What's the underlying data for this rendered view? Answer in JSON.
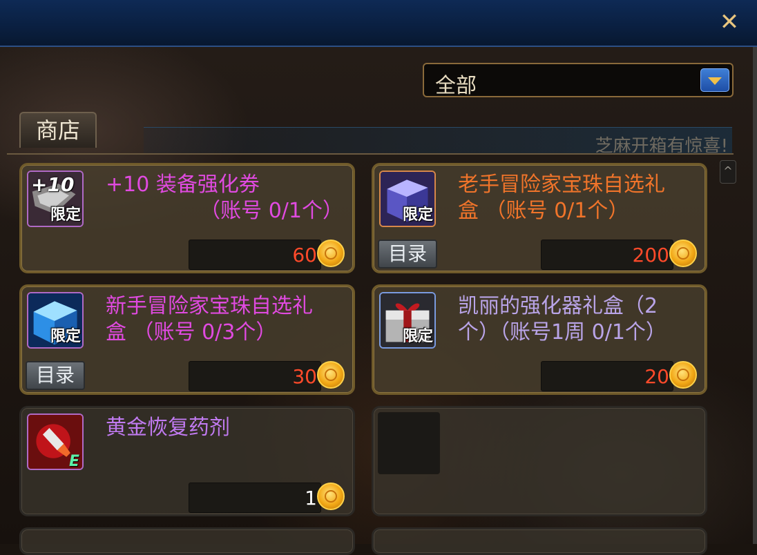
{
  "window": {
    "close_symbol": "✕"
  },
  "filter": {
    "selected": "全部"
  },
  "tabs": [
    {
      "label": "商店"
    }
  ],
  "banner": {
    "text": "芝麻开箱有惊喜!"
  },
  "scroll": {
    "up_symbol": "^"
  },
  "items": [
    {
      "name_line1": "+10 装备强化券",
      "name_line2": "（账号 0/1个）",
      "badge": "限定",
      "overlay": "+10",
      "price": "60",
      "catalog_label": ""
    },
    {
      "name_line1": "老手冒险家宝珠自选礼",
      "name_line2": "盒    （账号 0/1个）",
      "badge": "限定",
      "price": "200",
      "catalog_label": "目录"
    },
    {
      "name_line1": "新手冒险家宝珠自选礼",
      "name_line2": "盒    （账号 0/3个）",
      "badge": "限定",
      "price": "30",
      "catalog_label": "目录"
    },
    {
      "name_line1": "凯丽的强化器礼盒（2",
      "name_line2": "个）（账号1周 0/1个）",
      "badge": "限定",
      "price": "20",
      "catalog_label": ""
    },
    {
      "name_line1": "黄金恢复药剂",
      "name_line2": "",
      "badge": "E",
      "price": "1",
      "catalog_label": ""
    }
  ],
  "colors": {
    "name_pink": "#e04ae0",
    "name_orange": "#f0742a",
    "name_lilac": "#c07af0",
    "price_red": "#ff4a2a",
    "accent_gold": "#f2a816"
  },
  "icons": [
    "close-icon",
    "dropdown-arrow-icon",
    "coupon-icon",
    "gem-box-icon",
    "gift-box-icon",
    "potion-icon",
    "gold-coin-icon"
  ]
}
